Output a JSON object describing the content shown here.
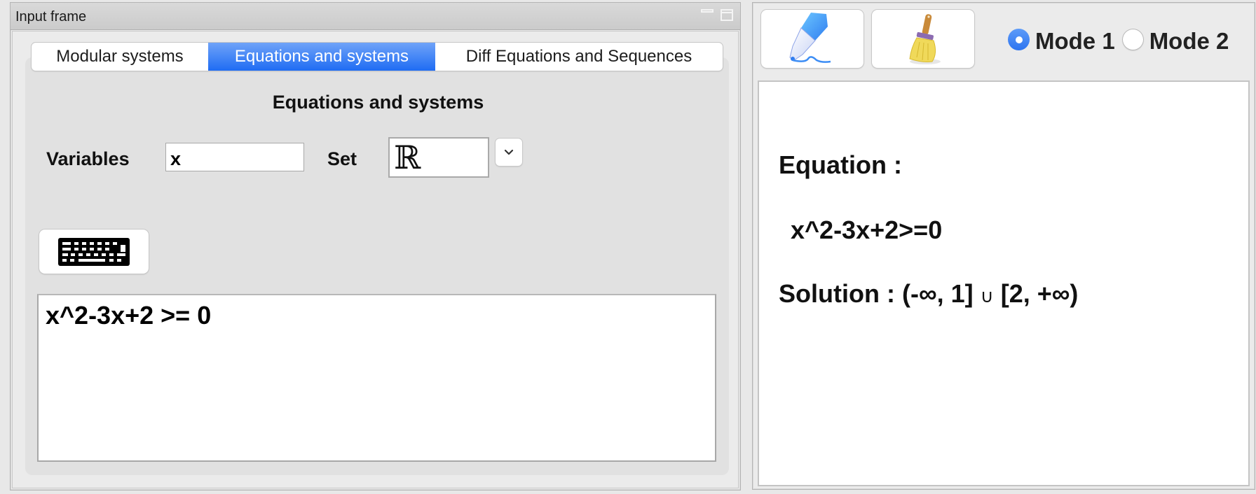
{
  "input_frame": {
    "title": "Input frame",
    "tabs": [
      {
        "label": "Modular systems",
        "active": false
      },
      {
        "label": "Equations and systems",
        "active": true
      },
      {
        "label": "Diff Equations and Sequences",
        "active": false
      }
    ],
    "section_heading": "Equations and systems",
    "variables_label": "Variables",
    "variables_value": "x",
    "set_label": "Set",
    "set_value": "ℝ",
    "keyboard_button_icon": "keyboard-icon",
    "input_text": "x^2-3x+2 >= 0"
  },
  "output_frame": {
    "toolbar": {
      "pencil_icon": "pencil-eraser-icon",
      "broom_icon": "broom-icon"
    },
    "modes": [
      {
        "label": "Mode 1",
        "selected": true
      },
      {
        "label": "Mode 2",
        "selected": false
      }
    ],
    "result": {
      "heading": "Equation :",
      "expression": "x^2-3x+2>=0",
      "solution_label": "Solution :",
      "solution_left": "(-∞, 1]",
      "union_symbol": "∪",
      "solution_right": "[2, +∞)"
    }
  },
  "colors": {
    "accent": "#1f6cf3",
    "accent_light": "#6fa3f8",
    "panel": "#e1e1e1",
    "frame_bg": "#ebebeb"
  }
}
